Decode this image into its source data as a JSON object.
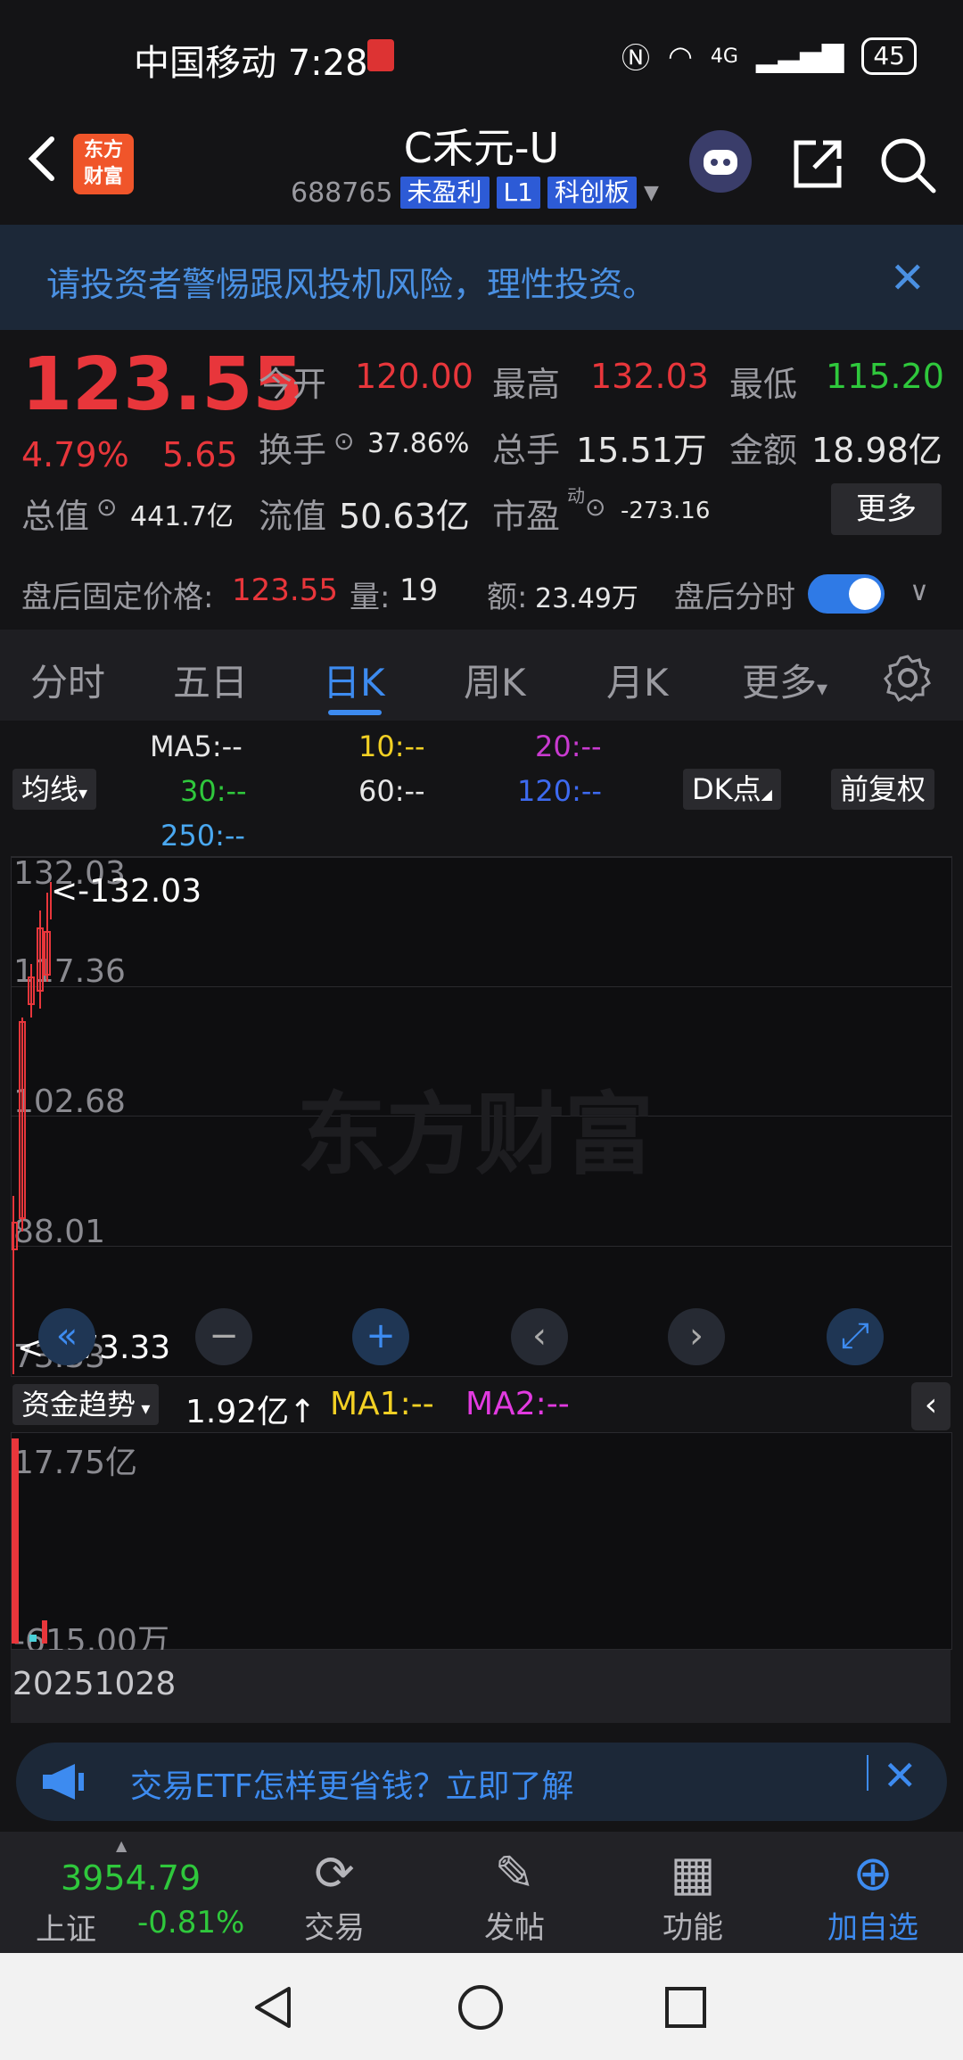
{
  "status_bar": {
    "carrier_time": "中国移动 7:28",
    "network": "4G",
    "battery": "45"
  },
  "header": {
    "stock_name": "C禾元-U",
    "code": "688765",
    "tags": [
      "未盈利",
      "L1",
      "科创板"
    ]
  },
  "banner": {
    "text": "请投资者警惕跟风投机风险，理性投资。"
  },
  "quote": {
    "price": "123.55",
    "change_pct": "4.79%",
    "change": "5.65",
    "open_label": "今开",
    "open": "120.00",
    "high_label": "最高",
    "high": "132.03",
    "low_label": "最低",
    "low": "115.20",
    "turnover_label": "换手",
    "turnover": "37.86%",
    "volume_label": "总手",
    "volume": "15.51万",
    "amount_label": "金额",
    "amount": "18.98亿",
    "mktcap_label": "总值",
    "mktcap": "441.7亿",
    "float_label": "流值",
    "float": "50.63亿",
    "pe_label": "市盈",
    "pe_sup": "动",
    "pe": "-273.16",
    "more": "更多"
  },
  "after_hours": {
    "label": "盘后固定价格:",
    "price": "123.55",
    "vol_label": "量:",
    "vol": "19",
    "amt_label": "额:",
    "amt": "23.49万",
    "toggle_label": "盘后分时",
    "toggle_on": true
  },
  "tabs": [
    "分时",
    "五日",
    "日K",
    "周K",
    "月K",
    "更多"
  ],
  "active_tab": "日K",
  "ma_legend": {
    "selector": "均线",
    "ma5": "MA5:--",
    "ma10": "10:--",
    "ma20": "20:--",
    "ma30": "30:--",
    "ma60": "60:--",
    "ma120": "120:--",
    "ma250": "250:--",
    "dk": "DK点",
    "adjust": "前复权"
  },
  "kchart": {
    "watermark": "东方财富",
    "y_ticks": [
      "132.03",
      "117.36",
      "102.68",
      "88.01",
      "73.33"
    ],
    "max_marker": "<-132.03",
    "min_marker": "<---73.33"
  },
  "flow": {
    "selector": "资金趋势",
    "value": "1.92亿↑",
    "ma1": "MA1:--",
    "ma2": "MA2:--",
    "top": "17.75亿",
    "bottom": "-615.00万",
    "date": "20251028"
  },
  "promo": {
    "text": "交易ETF怎样更省钱？立即了解"
  },
  "toolbar": {
    "index_value": "3954.79",
    "index_name": "上证",
    "index_change": "-0.81%",
    "trade": "交易",
    "post": "发帖",
    "functions": "功能",
    "add_watch": "加自选"
  }
}
